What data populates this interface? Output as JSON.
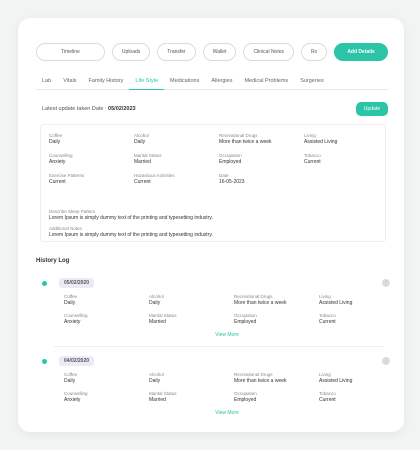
{
  "toolbar": {
    "filters": [
      "Timeline",
      "Uploads",
      "Transfer",
      "Wallet",
      "Clinical Notes",
      "Rx"
    ],
    "action_label": "Add Details"
  },
  "tabs": [
    "Lab",
    "Vitals",
    "Family History",
    "Life Style",
    "Medications",
    "Allergies",
    "Medical Problems",
    "Surgeries"
  ],
  "active_tab": "Life Style",
  "latest": {
    "label": "Latest update taken Date : ",
    "date": "05/02/2023",
    "button_label": "Update"
  },
  "current": {
    "row1": [
      {
        "label": "Coffee",
        "value": "Daily"
      },
      {
        "label": "Alcohol",
        "value": "Daily"
      },
      {
        "label": "Recreational Drugs",
        "value": "More than twice a week"
      },
      {
        "label": "Living",
        "value": "Assisted Living"
      }
    ],
    "row2": [
      {
        "label": "Counselling",
        "value": "Anxiety"
      },
      {
        "label": "Marital Status",
        "value": "Married"
      },
      {
        "label": "Occupation",
        "value": "Employed"
      },
      {
        "label": "Tobacco",
        "value": "Current"
      }
    ],
    "row3": [
      {
        "label": "Exercise Patterns",
        "value": "Current"
      },
      {
        "label": "Hazardous Activities",
        "value": "Current"
      },
      {
        "label": "Date",
        "value": "16-05-2023"
      }
    ],
    "sleep": {
      "label": "Describe Sleep Pattern",
      "value": "Lorem Ipsum is simply dummy text of the printing and typesetting industry."
    },
    "additional": {
      "label": "Additional Notes",
      "value": "Lorem Ipsum is simply dummy text of the printing and typesetting industry."
    }
  },
  "history": {
    "title": "History Log",
    "entries": [
      {
        "date": "05/02/2020",
        "row1": [
          {
            "label": "Coffee",
            "value": "Daily"
          },
          {
            "label": "Alcohol",
            "value": "Daily"
          },
          {
            "label": "Recreational Drugs",
            "value": "More than twice a week"
          },
          {
            "label": "Living",
            "value": "Assisted Living"
          }
        ],
        "row2": [
          {
            "label": "Counselling",
            "value": "Anxiety"
          },
          {
            "label": "Marital Status",
            "value": "Married"
          },
          {
            "label": "Occupation",
            "value": "Employed"
          },
          {
            "label": "Tobacco",
            "value": "Current"
          }
        ],
        "view_more": "View More"
      },
      {
        "date": "04/02/2020",
        "row1": [
          {
            "label": "Coffee",
            "value": "Daily"
          },
          {
            "label": "Alcohol",
            "value": "Daily"
          },
          {
            "label": "Recreational Drugs",
            "value": "More than twice a week"
          },
          {
            "label": "Living",
            "value": "Assisted Living"
          }
        ],
        "row2": [
          {
            "label": "Counselling",
            "value": "Anxiety"
          },
          {
            "label": "Marital Status",
            "value": "Married"
          },
          {
            "label": "Occupation",
            "value": "Employed"
          },
          {
            "label": "Tobacco",
            "value": "Current"
          }
        ],
        "view_more": "View More"
      }
    ]
  },
  "colors": {
    "accent": "#2bc4a6",
    "badge_bg": "#ecebf5"
  },
  "icons": [
    "more-options-icon",
    "timeline-dot-icon"
  ]
}
